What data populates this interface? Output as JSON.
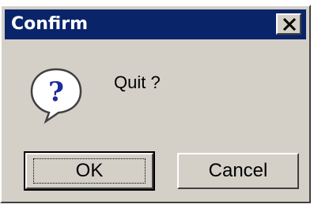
{
  "dialog": {
    "title": "Confirm",
    "message": "Quit ?",
    "icon": "question-icon",
    "buttons": {
      "ok_label": "OK",
      "cancel_label": "Cancel"
    },
    "close_icon": "close-icon"
  },
  "colors": {
    "titlebar": "#0a246a",
    "face": "#d4d0c8",
    "title_text": "#ffffff"
  }
}
